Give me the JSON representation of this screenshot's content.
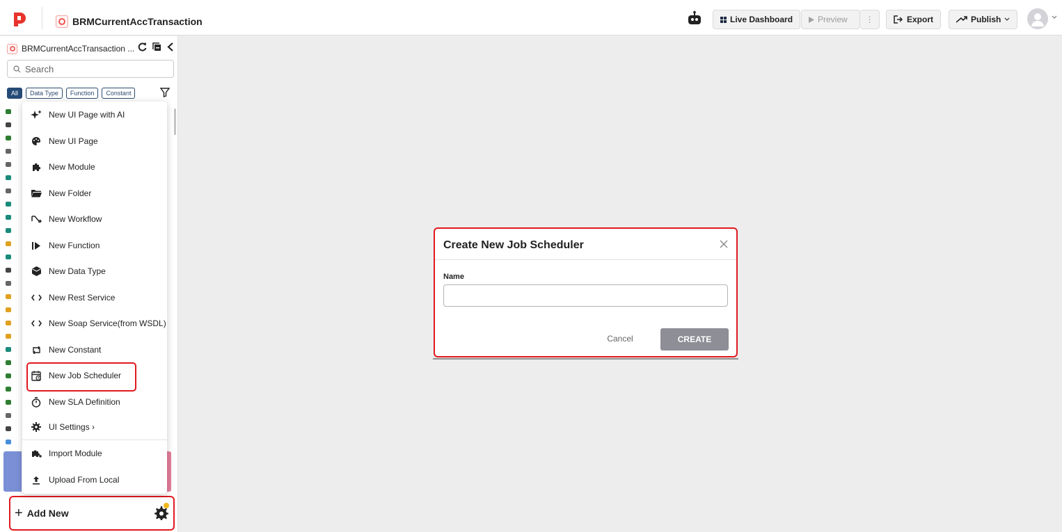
{
  "header": {
    "app_title": "BRMCurrentAccTransaction",
    "live_dashboard_label": "Live Dashboard",
    "preview_label": "Preview",
    "more_label": "⋮",
    "export_label": "Export",
    "publish_label": "Publish",
    "icons": [
      "logo-icon",
      "bot-icon",
      "dashboard-icon",
      "play-icon",
      "export-icon",
      "publish-icon",
      "chevron-down-icon",
      "user-avatar-icon"
    ]
  },
  "sidebar": {
    "project_name": "BRMCurrentAccTransaction ...",
    "search_placeholder": "Search",
    "filter_chips": [
      "All",
      "Data Type",
      "Function",
      "Constant"
    ],
    "add_new_label": "Add New"
  },
  "menu": {
    "items": [
      {
        "label": "New UI Page with AI",
        "icon": "sparkle-icon"
      },
      {
        "label": "New UI Page",
        "icon": "palette-icon"
      },
      {
        "label": "New Module",
        "icon": "puzzle-icon"
      },
      {
        "label": "New Folder",
        "icon": "folder-icon"
      },
      {
        "label": "New Workflow",
        "icon": "workflow-icon"
      },
      {
        "label": "New Function",
        "icon": "function-icon"
      },
      {
        "label": "New Data Type",
        "icon": "cube-icon"
      },
      {
        "label": "New Rest Service",
        "icon": "code-icon"
      },
      {
        "label": "New Soap Service(from WSDL)",
        "icon": "code-icon"
      },
      {
        "label": "New Constant",
        "icon": "constant-icon"
      },
      {
        "label": "New Job Scheduler",
        "icon": "calendar-clock-icon"
      },
      {
        "label": "New SLA Definition",
        "icon": "stopwatch-icon"
      },
      {
        "label": "UI Settings  ›",
        "icon": "gear-icon"
      },
      {
        "label": "Import Module",
        "icon": "import-puzzle-icon"
      },
      {
        "label": "Upload From Local",
        "icon": "upload-icon"
      }
    ]
  },
  "dialog": {
    "title": "Create New Job Scheduler",
    "name_label": "Name",
    "name_value": "",
    "cancel_label": "Cancel",
    "create_label": "CREATE"
  },
  "colors": {
    "accent_red": "#e0191f",
    "chip_blue": "#244a78",
    "create_disabled": "#8e8e96"
  }
}
